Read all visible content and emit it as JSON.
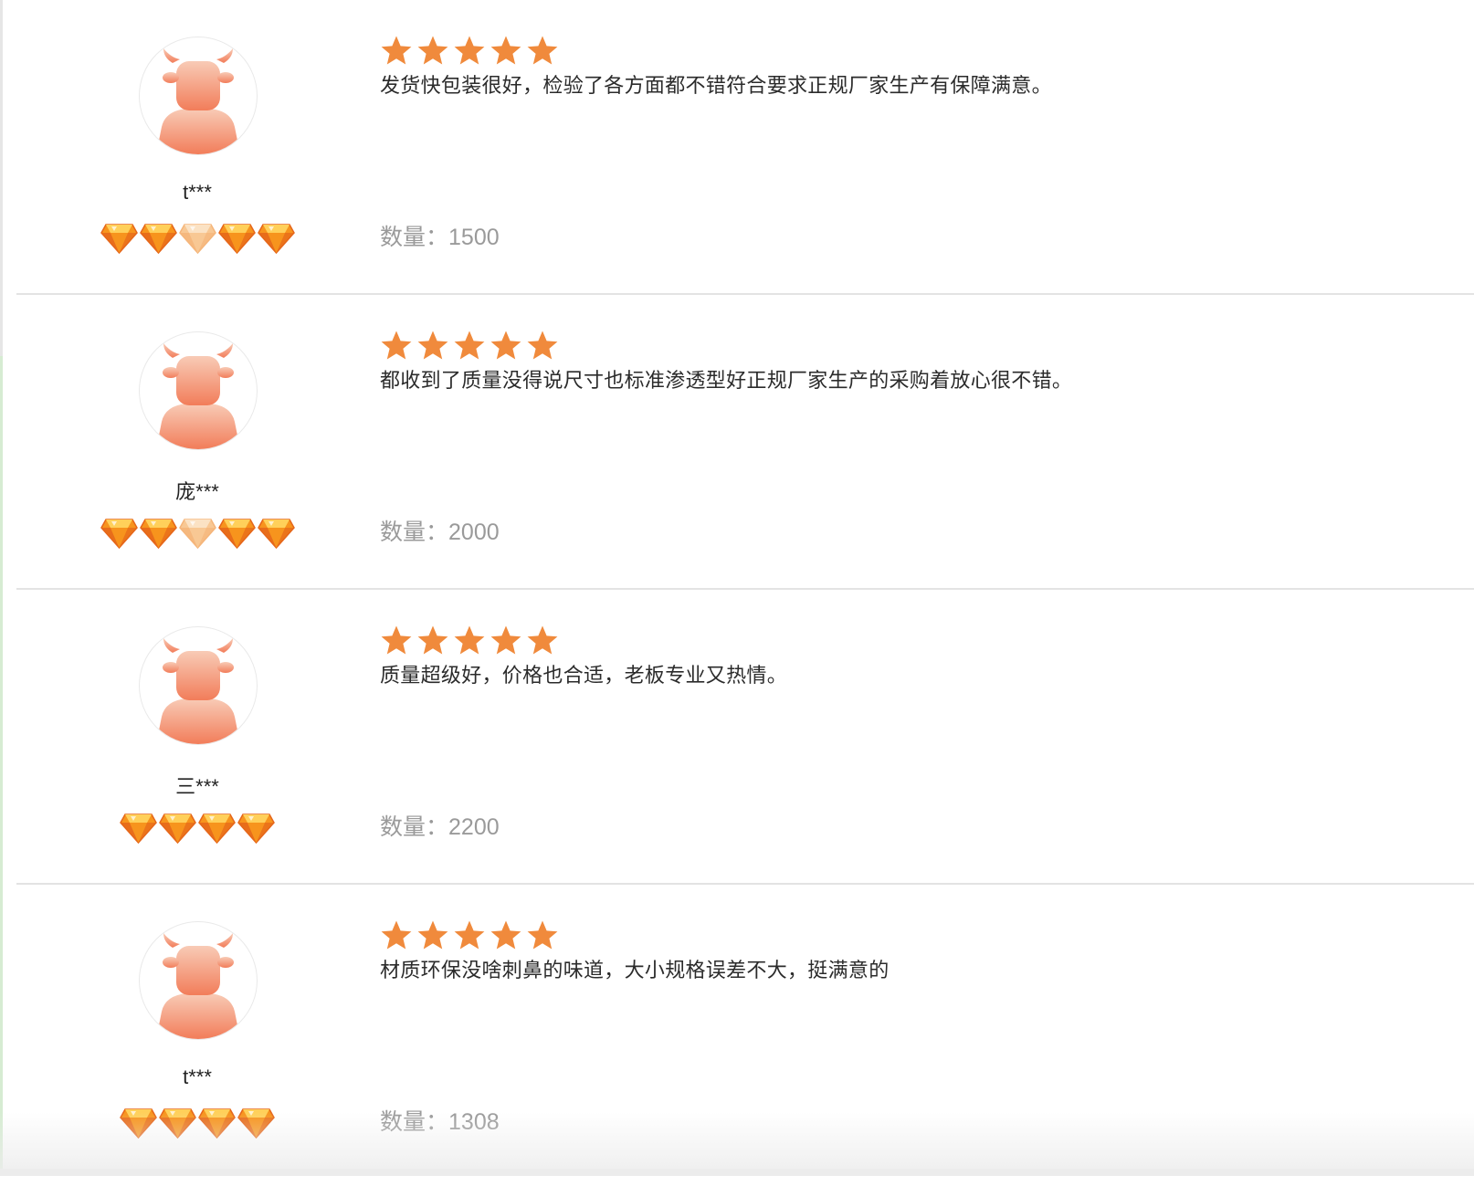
{
  "reviews": [
    {
      "username": "t***",
      "gem_count": 5,
      "faded_gem_index": 2,
      "star_rating": 5,
      "text": "发货快包装很好，检验了各方面都不错符合要求正规厂家生产有保障满意。",
      "quantity_label": "数量：",
      "quantity_value": "1500"
    },
    {
      "username": "庞***",
      "gem_count": 5,
      "faded_gem_index": 2,
      "star_rating": 5,
      "text": "都收到了质量没得说尺寸也标准渗透型好正规厂家生产的采购着放心很不错。",
      "quantity_label": "数量：",
      "quantity_value": "2000"
    },
    {
      "username": "三***",
      "gem_count": 4,
      "faded_gem_index": null,
      "star_rating": 5,
      "text": "质量超级好，价格也合适，老板专业又热情。",
      "quantity_label": "数量：",
      "quantity_value": "2200"
    },
    {
      "username": "t***",
      "gem_count": 4,
      "faded_gem_index": null,
      "star_rating": 5,
      "text": "材质环保没啥刺鼻的味道，大小规格误差不大，挺满意的",
      "quantity_label": "数量：",
      "quantity_value": "1308"
    }
  ],
  "icons": {
    "avatar": "cow-avatar-icon",
    "gem": "diamond-icon",
    "star": "star-icon"
  },
  "colors": {
    "star": "#f08a3c",
    "gem": "#f7941d",
    "avatar_top": "#f8cbb6",
    "avatar_bottom": "#f27d5a"
  }
}
